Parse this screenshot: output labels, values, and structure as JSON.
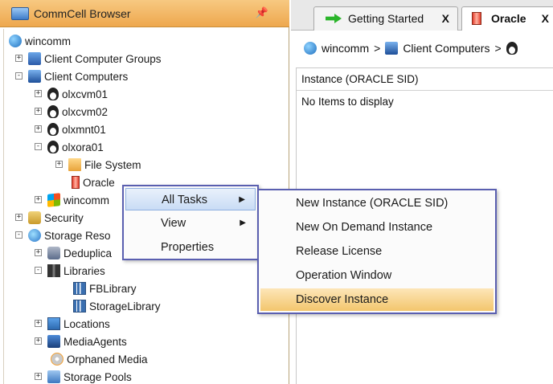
{
  "left_panel": {
    "title": "CommCell Browser",
    "pin": "p",
    "tree": [
      {
        "label": "wincomm"
      },
      {
        "label": "Client Computer Groups"
      },
      {
        "label": "Client Computers"
      },
      {
        "label": "olxcvm01"
      },
      {
        "label": "olxcvm02"
      },
      {
        "label": "olxmnt01"
      },
      {
        "label": "olxora01"
      },
      {
        "label": "File System"
      },
      {
        "label": "Oracle"
      },
      {
        "label": "wincomm"
      },
      {
        "label": "Security"
      },
      {
        "label": "Storage Reso"
      },
      {
        "label": "Deduplica"
      },
      {
        "label": "Libraries"
      },
      {
        "label": "FBLibrary"
      },
      {
        "label": "StorageLibrary"
      },
      {
        "label": "Locations"
      },
      {
        "label": "MediaAgents"
      },
      {
        "label": "Orphaned Media"
      },
      {
        "label": "Storage Pools"
      }
    ]
  },
  "right_panel": {
    "tabs": [
      {
        "label": "Getting Started",
        "close": "X"
      },
      {
        "label": "Oracle",
        "close": "X"
      }
    ],
    "breadcrumb": {
      "root": "wincomm",
      "sep": ">",
      "item": "Client Computers",
      "sep2": ">"
    },
    "column_header": "Instance (ORACLE SID)",
    "empty_text": "No Items to display"
  },
  "context_menu": {
    "items": [
      {
        "label": "All Tasks",
        "arrow": "▶"
      },
      {
        "label": "View",
        "arrow": "▶"
      },
      {
        "label": "Properties"
      }
    ]
  },
  "submenu": {
    "items": [
      {
        "label": "New Instance (ORACLE SID)"
      },
      {
        "label": "New On Demand Instance"
      },
      {
        "label": "Release License"
      },
      {
        "label": "Operation Window"
      },
      {
        "label": "Discover Instance"
      }
    ]
  },
  "colors": {
    "header_orange": "#eea84e",
    "menu_border": "#5a5fb0",
    "highlight_orange": "#f3c66d"
  }
}
